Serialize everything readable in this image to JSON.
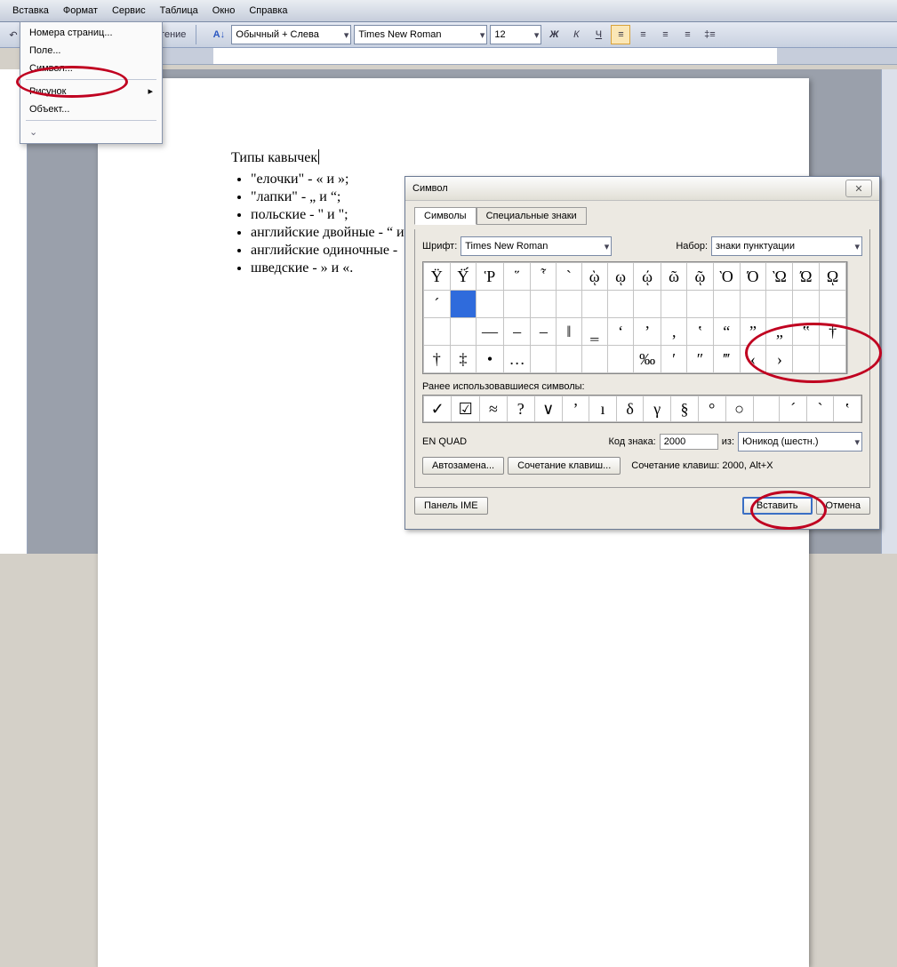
{
  "menubar": [
    "Вставка",
    "Формат",
    "Сервис",
    "Таблица",
    "Окно",
    "Справка"
  ],
  "dropdown": {
    "items": [
      "Номера страниц...",
      "Поле...",
      "Символ...",
      "Рисунок",
      "Объект..."
    ]
  },
  "toolbar": {
    "reading": "Чтение",
    "style": "Обычный + Слева",
    "font": "Times New Roman",
    "size": "12"
  },
  "doc": {
    "title": "Типы кавычек",
    "items": [
      "\"елочки\" - « и »;",
      "\"лапки\" - „ и “;",
      "польские - \" и \";",
      "английские двойные - “ и",
      "английские одиночные -",
      "шведские - » и «."
    ]
  },
  "dialog": {
    "title": "Символ",
    "tabs": [
      "Символы",
      "Специальные знаки"
    ],
    "font_label": "Шрифт:",
    "font": "Times New Roman",
    "set_label": "Набор:",
    "set": "знаки пунктуации",
    "recent_label": "Ранее использовавшиеся символы:",
    "name": "EN QUAD",
    "code_label": "Код знака:",
    "code": "2000",
    "from_label": "из:",
    "from": "Юникод (шестн.)",
    "autocorrect": "Автозамена...",
    "shortcut": "Сочетание клавиш...",
    "shortcut_text": "Сочетание клавиш: 2000, Alt+X",
    "ime": "Панель IME",
    "insert": "Вставить",
    "cancel": "Отмена",
    "grid": [
      [
        "Ϋ",
        "Ϋ́",
        "Ῥ",
        "῞",
        "῟",
        "`",
        "ῲ",
        "ῳ",
        "ῴ",
        "ῶ",
        "ῷ",
        "Ὸ",
        "Ό",
        "Ὼ",
        "Ώ",
        "ῼ"
      ],
      [
        "´",
        "",
        "",
        "",
        "",
        "",
        "",
        "",
        "",
        "",
        "",
        "",
        "",
        "",
        "",
        ""
      ],
      [
        "",
        "",
        "—",
        "–",
        "‒",
        "‖",
        "‗",
        "‘",
        "’",
        "‚",
        "‛",
        "“",
        "”",
        "„",
        "‟",
        "†"
      ],
      [
        "†",
        "‡",
        "•",
        "…",
        "",
        "",
        "",
        "",
        "‰",
        "′",
        "″",
        "‴",
        "‹",
        "›",
        "",
        ""
      ]
    ],
    "grid_sel": [
      1,
      1
    ],
    "recent": [
      "✓",
      "☑",
      "≈",
      "?",
      "∨",
      "ʼ",
      "ı",
      "δ",
      "γ",
      "§",
      "°",
      "○",
      "",
      "´",
      "`",
      "ʽ"
    ]
  }
}
